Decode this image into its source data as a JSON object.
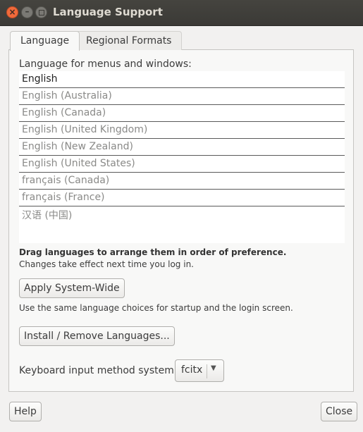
{
  "window": {
    "title": "Language Support",
    "close_glyph": "×",
    "minimize_glyph": "–"
  },
  "tabs": [
    {
      "label": "Language",
      "active": true
    },
    {
      "label": "Regional Formats",
      "active": false
    }
  ],
  "language_section": {
    "heading": "Language for menus and windows:",
    "languages": [
      "English",
      "English (Australia)",
      "English (Canada)",
      "English (United Kingdom)",
      "English (New Zealand)",
      "English (United States)",
      "français (Canada)",
      "français (France)",
      "汉语 (中国)"
    ],
    "drag_hint": "Drag languages to arrange them in order of preference.",
    "effect_note": "Changes take effect next time you log in.",
    "apply_button": "Apply System-Wide",
    "apply_note": "Use the same language choices for startup and the login screen.",
    "install_button": "Install / Remove Languages...",
    "input_method_label": "Keyboard input method system:",
    "input_method_value": "fcitx",
    "dropdown_icon": "chevron-down-icon"
  },
  "footer": {
    "help_button": "Help",
    "close_button": "Close"
  },
  "colors": {
    "titlebar": "#3c3b37",
    "close_button": "#f06a3b",
    "window_bg": "#f2f1f0"
  }
}
